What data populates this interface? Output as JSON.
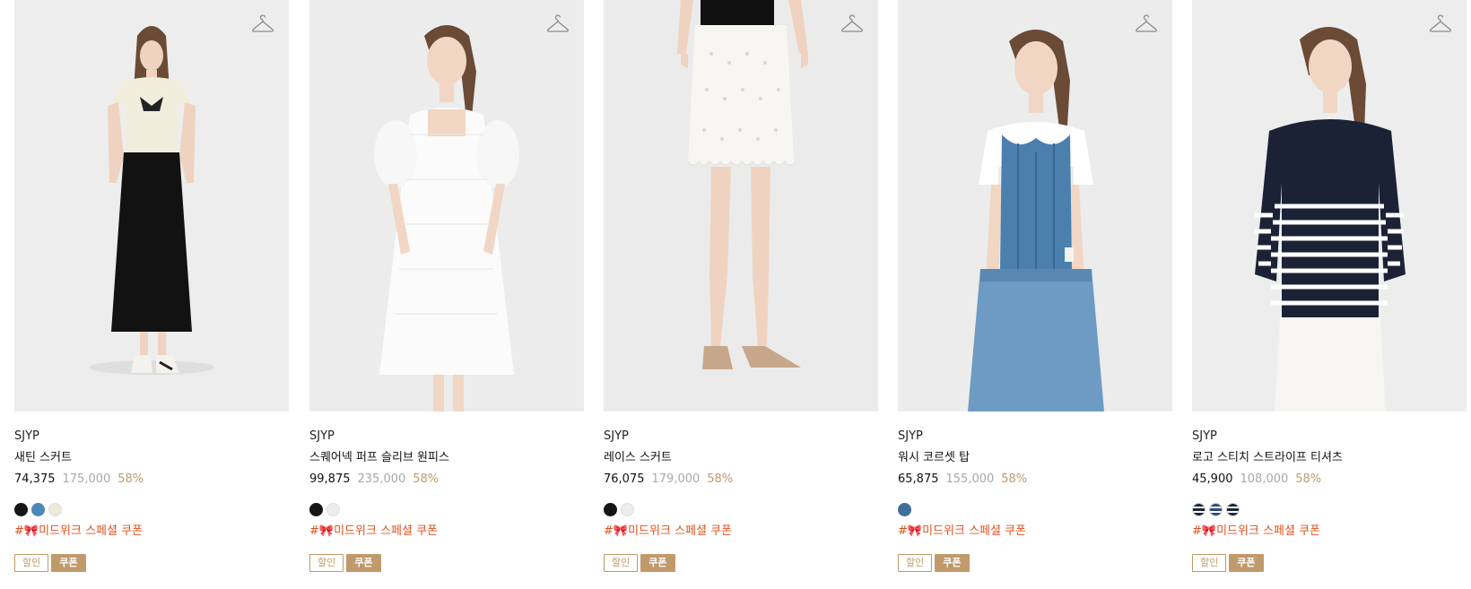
{
  "products": [
    {
      "brand": "SJYP",
      "name": "새틴 스커트",
      "sale_price": "74,375",
      "original_price": "175,000",
      "discount_rate": "58%",
      "swatches": [
        "#151515",
        "#4a88b8",
        "#ece8dc"
      ],
      "coupon_prefix": "#",
      "coupon_emoji": "🎀",
      "coupon_text": "미드위크 스페셜 쿠폰",
      "badge_sale": "할인",
      "badge_coupon": "쿠폰",
      "icon": "hanger-icon"
    },
    {
      "brand": "SJYP",
      "name": "스퀘어넥 퍼프 슬리브 원피스",
      "sale_price": "99,875",
      "original_price": "235,000",
      "discount_rate": "58%",
      "swatches": [
        "#151515",
        "#ececec"
      ],
      "coupon_prefix": "#",
      "coupon_emoji": "🎀",
      "coupon_text": "미드위크 스페셜 쿠폰",
      "badge_sale": "할인",
      "badge_coupon": "쿠폰",
      "icon": "hanger-icon"
    },
    {
      "brand": "SJYP",
      "name": "레이스 스커트",
      "sale_price": "76,075",
      "original_price": "179,000",
      "discount_rate": "58%",
      "swatches": [
        "#151515",
        "#ececec"
      ],
      "coupon_prefix": "#",
      "coupon_emoji": "🎀",
      "coupon_text": "미드위크 스페셜 쿠폰",
      "badge_sale": "할인",
      "badge_coupon": "쿠폰",
      "icon": "hanger-icon"
    },
    {
      "brand": "SJYP",
      "name": "워시 코르셋 탑",
      "sale_price": "65,875",
      "original_price": "155,000",
      "discount_rate": "58%",
      "swatches": [
        "#3f6f98"
      ],
      "coupon_prefix": "#",
      "coupon_emoji": "🎀",
      "coupon_text": "미드위크 스페셜 쿠폰",
      "badge_sale": "할인",
      "badge_coupon": "쿠폰",
      "icon": "hanger-icon"
    },
    {
      "brand": "SJYP",
      "name": "로고 스티치 스트라이프 티셔츠",
      "sale_price": "45,900",
      "original_price": "108,000",
      "discount_rate": "58%",
      "swatches": [
        "stripe-navy",
        "stripe-blue",
        "stripe-navy"
      ],
      "coupon_prefix": "#",
      "coupon_emoji": "🎀",
      "coupon_text": "미드위크 스페셜 쿠폰",
      "badge_sale": "할인",
      "badge_coupon": "쿠폰",
      "icon": "hanger-icon"
    }
  ],
  "colors": {
    "accent": "#c09a6b",
    "coupon_text": "#e0521f",
    "original_price": "#a8a8a8",
    "image_background": "#ededed"
  }
}
